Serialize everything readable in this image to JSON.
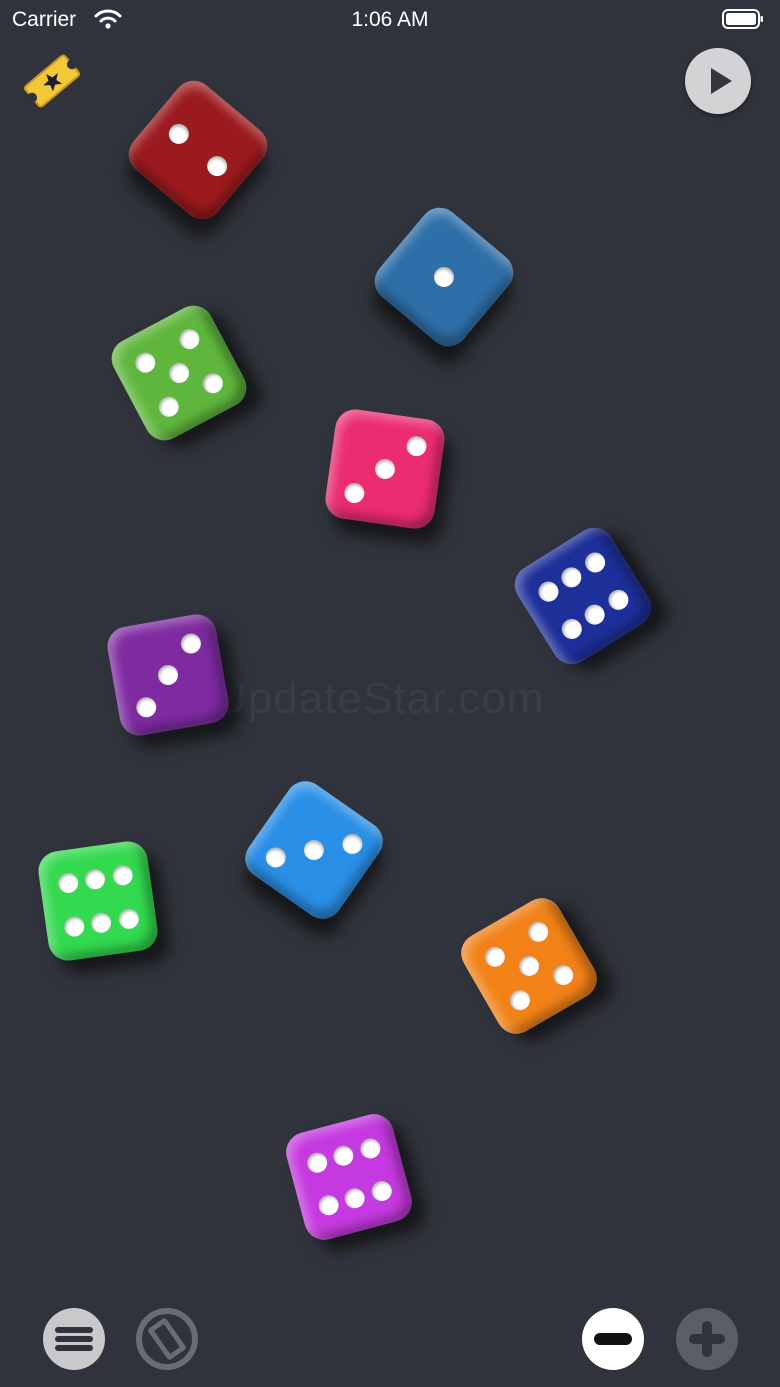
{
  "status_bar": {
    "carrier": "Carrier",
    "time": "1:06 AM"
  },
  "watermark": "UpdateStar.com",
  "dice": [
    {
      "color": "#9b1a1e",
      "value": 2
    },
    {
      "color": "#2e6fa8",
      "value": 1
    },
    {
      "color": "#5fb63d",
      "value": 5
    },
    {
      "color": "#ec2c71",
      "value": 3
    },
    {
      "color": "#1d2f98",
      "value": 6
    },
    {
      "color": "#7e2ba1",
      "value": 3
    },
    {
      "color": "#2a8fe6",
      "value": 3
    },
    {
      "color": "#33d94f",
      "value": 6
    },
    {
      "color": "#f28218",
      "value": 5
    },
    {
      "color": "#c53ae0",
      "value": 6
    }
  ],
  "icons": {
    "ticket": "ticket-star-icon",
    "play": "play-icon",
    "menu": "menu-icon",
    "rotate": "rotate-icon",
    "minus": "minus-icon",
    "plus": "plus-icon"
  }
}
